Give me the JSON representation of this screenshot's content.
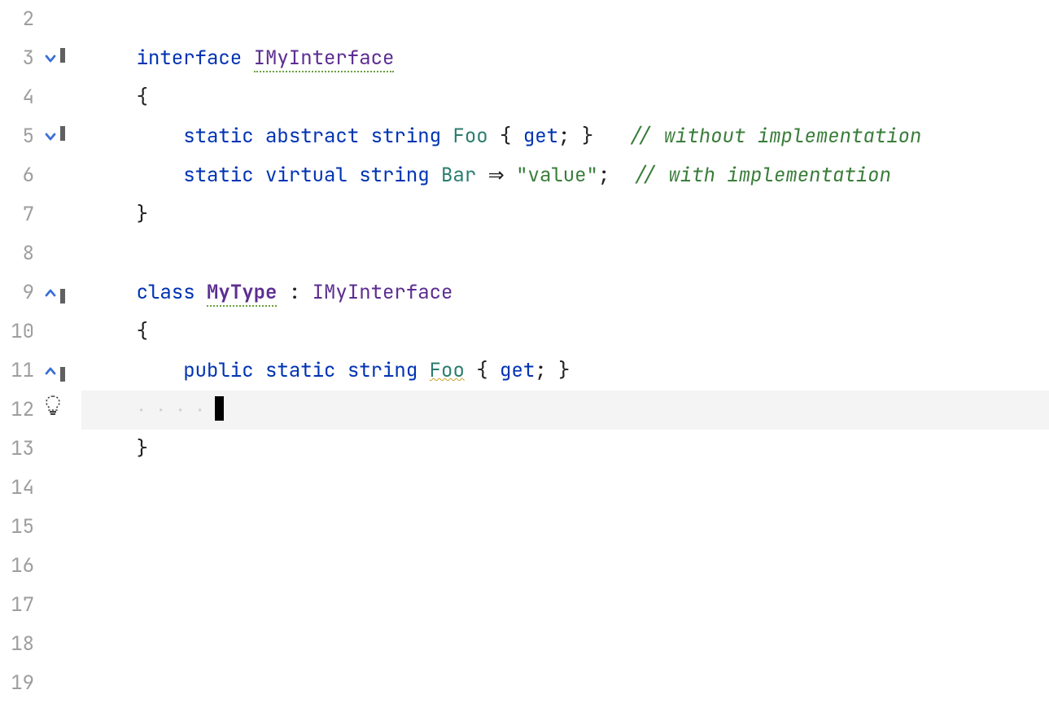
{
  "lines": {
    "l2": {
      "num": "2"
    },
    "l3": {
      "num": "3",
      "kw_interface": "interface ",
      "type_name": "IMyInterface"
    },
    "l4": {
      "num": "4",
      "text": "{"
    },
    "l5": {
      "num": "5",
      "kw_static": "static ",
      "kw_abstract": "abstract ",
      "kw_string": "string ",
      "member": "Foo",
      "rest": " { ",
      "kw_get": "get",
      "rest2": "; }   ",
      "comment": "// without implementation"
    },
    "l6": {
      "num": "6",
      "kw_static": "static ",
      "kw_virtual": "virtual ",
      "kw_string": "string ",
      "member": "Bar",
      "arrow": " ⇒ ",
      "str": "\"value\"",
      "semi": ";  ",
      "comment": "// with implementation"
    },
    "l7": {
      "num": "7",
      "text": "}"
    },
    "l8": {
      "num": "8"
    },
    "l9": {
      "num": "9",
      "kw_class": "class ",
      "type_name": "MyType",
      "colon": " : ",
      "iface": "IMyInterface"
    },
    "l10": {
      "num": "10",
      "text": "{"
    },
    "l11": {
      "num": "11",
      "kw_public": "public ",
      "kw_static": "static ",
      "kw_string": "string ",
      "member": "Foo",
      "rest": " { ",
      "kw_get": "get",
      "rest2": "; }"
    },
    "l12": {
      "num": "12"
    },
    "l13": {
      "num": "13",
      "text": "}"
    },
    "l14": {
      "num": "14"
    },
    "l15": {
      "num": "15"
    },
    "l16": {
      "num": "16"
    },
    "l17": {
      "num": "17"
    },
    "l18": {
      "num": "18"
    },
    "l19": {
      "num": "19"
    }
  },
  "indent": {
    "one": "    ",
    "two": "        ",
    "dots4": "· · · · "
  }
}
